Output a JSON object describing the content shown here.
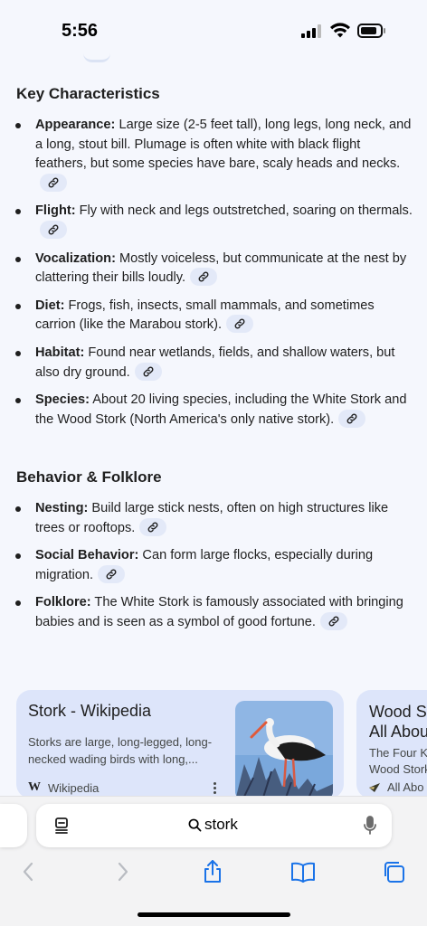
{
  "status_bar": {
    "time": "5:56"
  },
  "sections": [
    {
      "heading": "Key Characteristics",
      "items": [
        {
          "term": "Appearance:",
          "text": " Large size (2-5 feet tall), long legs, long neck, and a long, stout bill. Plumage is often white with black flight feathers, but some species have bare, scaly heads and necks."
        },
        {
          "term": "Flight:",
          "text": " Fly with neck and legs outstretched, soaring on thermals."
        },
        {
          "term": "Vocalization:",
          "text": " Mostly voiceless, but communicate at the nest by clattering their bills loudly."
        },
        {
          "term": "Diet:",
          "text": " Frogs, fish, insects, small mammals, and sometimes carrion (like the Marabou stork)."
        },
        {
          "term": "Habitat:",
          "text": " Found near wetlands, fields, and shallow waters, but also dry ground."
        },
        {
          "term": "Species:",
          "text": " About 20 living species, including the White Stork and the Wood Stork (North America's only native stork)."
        }
      ]
    },
    {
      "heading": "Behavior & Folklore",
      "items": [
        {
          "term": "Nesting:",
          "text": " Build large stick nests, often on high structures like trees or rooftops."
        },
        {
          "term": "Social Behavior:",
          "text": " Can form large flocks, especially during migration."
        },
        {
          "term": "Folklore:",
          "text": " The White Stork is famously associated with bringing babies and is seen as a symbol of good fortune."
        }
      ]
    }
  ],
  "cards": [
    {
      "title": "Stork - Wikipedia",
      "description": "Storks are large, long-legged, long-necked wading birds with long,...",
      "source": "Wikipedia",
      "source_icon": "W"
    },
    {
      "title_line1": "Wood St",
      "title_line2": "All Abou",
      "desc_line1": "The Four K",
      "desc_line2": "Wood Stork",
      "source": "All Abo"
    }
  ],
  "address_bar": {
    "query": "stork"
  },
  "icons": {
    "link": "link-icon",
    "tabs": "tab-overview-icon",
    "search": "search-icon",
    "mic": "microphone-icon",
    "back": "chevron-left-icon",
    "forward": "chevron-right-icon",
    "share": "share-icon",
    "bookmarks": "book-icon",
    "tab_switcher": "tabs-icon"
  },
  "colors": {
    "background": "#f5f7fd",
    "card": "#dde5fa",
    "chip": "#e3e9f8",
    "accent": "#1a73e8"
  }
}
